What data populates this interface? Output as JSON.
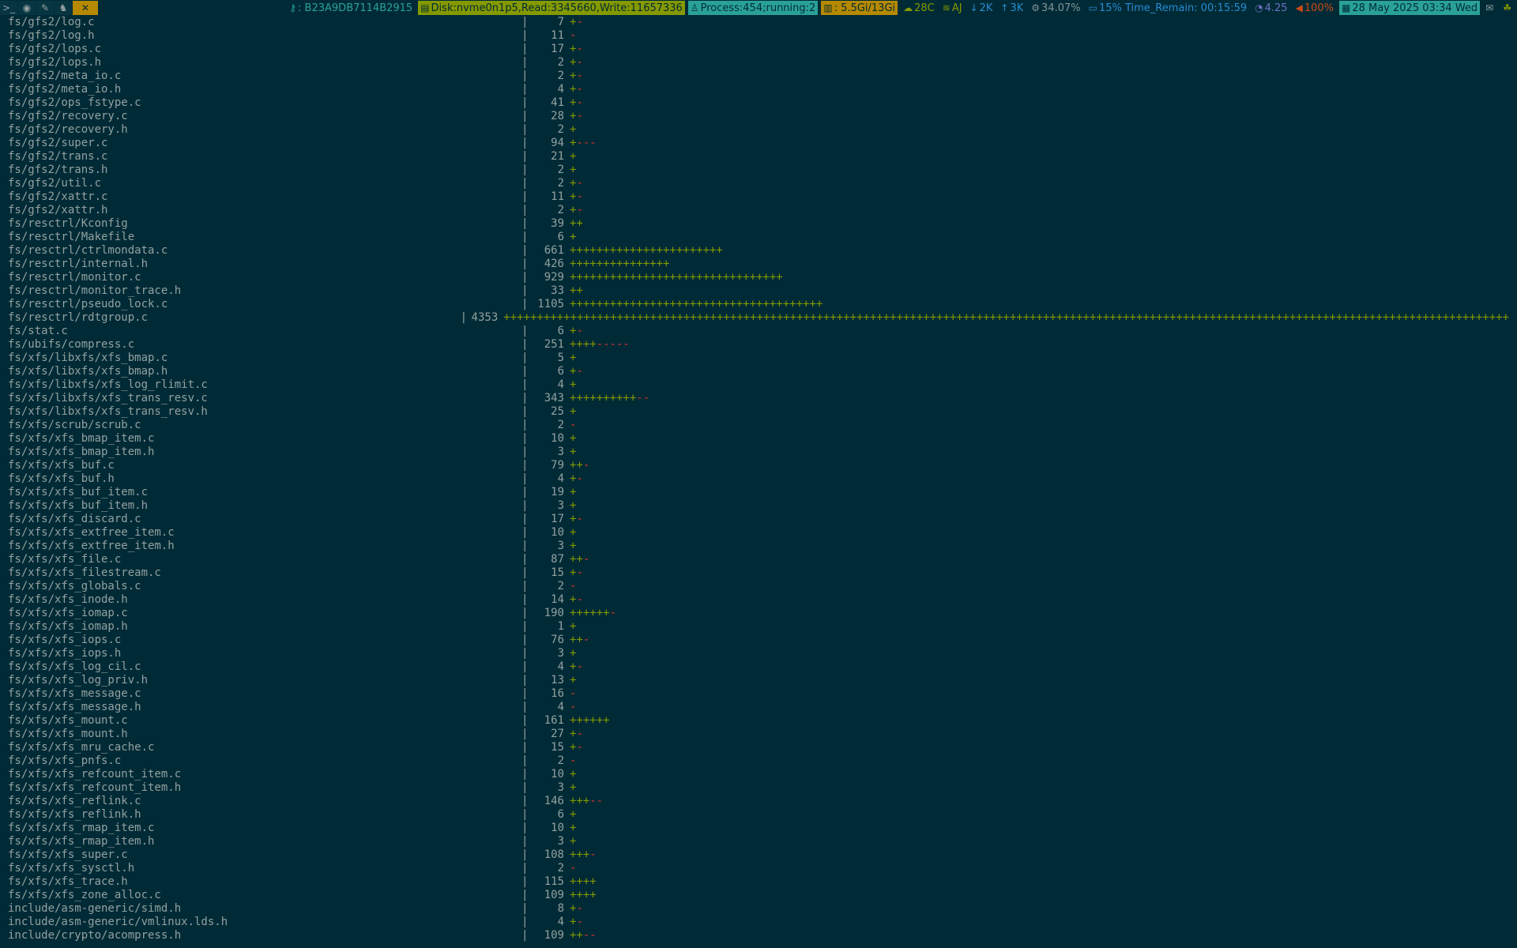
{
  "statusbar": {
    "workspaces": [
      {
        "icon": "terminal-icon",
        "glyph": ">_",
        "active": false
      },
      {
        "icon": "browser-icon",
        "glyph": "◉",
        "active": false
      },
      {
        "icon": "edit-icon",
        "glyph": "✎",
        "active": false
      },
      {
        "icon": "linux-icon",
        "glyph": "♞",
        "active": false
      },
      {
        "icon": "tools-icon",
        "glyph": "✕",
        "active": true
      }
    ],
    "blocks": [
      {
        "name": "key-status",
        "icon": "key-icon",
        "glyph": "⚷",
        "text": ": B23A9DB7114B2915",
        "fg": "#2aa198",
        "bg": "transparent"
      },
      {
        "name": "disk-status",
        "icon": "disk-icon",
        "glyph": "▤",
        "text": "Disk:nvme0n1p5,Read:3345660,Write:11657336",
        "fg": "#002b36",
        "bg": "#859900"
      },
      {
        "name": "process-status",
        "icon": "process-icon",
        "glyph": "♙",
        "text": "Process:454;running:2",
        "fg": "#002b36",
        "bg": "#2aa198"
      },
      {
        "name": "memory-status",
        "icon": "chart-icon",
        "glyph": "▥",
        "text": ": 5.5Gi/13Gi",
        "fg": "#002b36",
        "bg": "#b58900"
      },
      {
        "name": "temperature-status",
        "icon": "cloud-icon",
        "glyph": "☁",
        "text": "28C",
        "fg": "#859900",
        "bg": "transparent"
      },
      {
        "name": "wifi-status",
        "icon": "wifi-icon",
        "glyph": "≋",
        "text": "AJ",
        "fg": "#859900",
        "bg": "transparent"
      },
      {
        "name": "download-status",
        "icon": "download-icon",
        "glyph": "↓",
        "text": "2K",
        "fg": "#268bd2",
        "bg": "transparent"
      },
      {
        "name": "upload-status",
        "icon": "upload-icon",
        "glyph": "↑",
        "text": "3K",
        "fg": "#268bd2",
        "bg": "transparent"
      },
      {
        "name": "cpu-status",
        "icon": "gear-icon",
        "glyph": "⚙",
        "text": "34.07%",
        "fg": "#839496",
        "bg": "transparent"
      },
      {
        "name": "battery-status",
        "icon": "battery-icon",
        "glyph": "▭",
        "text": "15% Time_Remain: 00:15:59",
        "fg": "#268bd2",
        "bg": "transparent"
      },
      {
        "name": "load-status",
        "icon": "gauge-icon",
        "glyph": "◔",
        "text": "4.25",
        "fg": "#6c71c4",
        "bg": "transparent"
      },
      {
        "name": "volume-status",
        "icon": "volume-icon",
        "glyph": "◀",
        "text": "100%",
        "fg": "#cb4b16",
        "bg": "transparent"
      },
      {
        "name": "date-status",
        "icon": "calendar-icon",
        "glyph": "▦",
        "text": "28 May 2025 03:34 Wed",
        "fg": "#002b36",
        "bg": "#2aa198"
      },
      {
        "name": "mail-tray",
        "icon": "mail-icon",
        "glyph": "✉",
        "text": "",
        "fg": "#93a1a1",
        "bg": "transparent"
      },
      {
        "name": "network-tray",
        "icon": "network-icon",
        "glyph": "☘",
        "text": "",
        "fg": "#859900",
        "bg": "transparent"
      }
    ]
  },
  "terminal": {
    "separator": "|",
    "rows": [
      {
        "file": "fs/gfs2/log.c",
        "count": "7",
        "plus": "+",
        "minus": "-"
      },
      {
        "file": "fs/gfs2/log.h",
        "count": "11",
        "plus": "",
        "minus": "-"
      },
      {
        "file": "fs/gfs2/lops.c",
        "count": "17",
        "plus": "+",
        "minus": "-"
      },
      {
        "file": "fs/gfs2/lops.h",
        "count": "2",
        "plus": "+",
        "minus": "-"
      },
      {
        "file": "fs/gfs2/meta_io.c",
        "count": "2",
        "plus": "+",
        "minus": "-"
      },
      {
        "file": "fs/gfs2/meta_io.h",
        "count": "4",
        "plus": "+",
        "minus": "-"
      },
      {
        "file": "fs/gfs2/ops_fstype.c",
        "count": "41",
        "plus": "+",
        "minus": "-"
      },
      {
        "file": "fs/gfs2/recovery.c",
        "count": "28",
        "plus": "+",
        "minus": "-"
      },
      {
        "file": "fs/gfs2/recovery.h",
        "count": "2",
        "plus": "+",
        "minus": ""
      },
      {
        "file": "fs/gfs2/super.c",
        "count": "94",
        "plus": "+",
        "minus": "---"
      },
      {
        "file": "fs/gfs2/trans.c",
        "count": "21",
        "plus": "+",
        "minus": ""
      },
      {
        "file": "fs/gfs2/trans.h",
        "count": "2",
        "plus": "+",
        "minus": ""
      },
      {
        "file": "fs/gfs2/util.c",
        "count": "2",
        "plus": "+",
        "minus": "-"
      },
      {
        "file": "fs/gfs2/xattr.c",
        "count": "11",
        "plus": "+",
        "minus": "-"
      },
      {
        "file": "fs/gfs2/xattr.h",
        "count": "2",
        "plus": "+",
        "minus": "-"
      },
      {
        "file": "fs/resctrl/Kconfig",
        "count": "39",
        "plus": "++",
        "minus": ""
      },
      {
        "file": "fs/resctrl/Makefile",
        "count": "6",
        "plus": "+",
        "minus": ""
      },
      {
        "file": "fs/resctrl/ctrlmondata.c",
        "count": "661",
        "plus": "+++++++++++++++++++++++",
        "minus": ""
      },
      {
        "file": "fs/resctrl/internal.h",
        "count": "426",
        "plus": "+++++++++++++++",
        "minus": ""
      },
      {
        "file": "fs/resctrl/monitor.c",
        "count": "929",
        "plus": "++++++++++++++++++++++++++++++++",
        "minus": ""
      },
      {
        "file": "fs/resctrl/monitor_trace.h",
        "count": "33",
        "plus": "++",
        "minus": ""
      },
      {
        "file": "fs/resctrl/pseudo_lock.c",
        "count": "1105",
        "plus": "++++++++++++++++++++++++++++++++++++++",
        "minus": ""
      },
      {
        "file": "fs/resctrl/rdtgroup.c",
        "count": "4353",
        "plus": "+++++++++++++++++++++++++++++++++++++++++++++++++++++++++++++++++++++++++++++++++++++++++++++++++++++++++++++++++++++++++++++++++++++++++++++++++++++++",
        "minus": ""
      },
      {
        "file": "fs/stat.c",
        "count": "6",
        "plus": "+",
        "minus": "-"
      },
      {
        "file": "fs/ubifs/compress.c",
        "count": "251",
        "plus": "++++",
        "minus": "-----"
      },
      {
        "file": "fs/xfs/libxfs/xfs_bmap.c",
        "count": "5",
        "plus": "+",
        "minus": ""
      },
      {
        "file": "fs/xfs/libxfs/xfs_bmap.h",
        "count": "6",
        "plus": "+",
        "minus": "-"
      },
      {
        "file": "fs/xfs/libxfs/xfs_log_rlimit.c",
        "count": "4",
        "plus": "+",
        "minus": ""
      },
      {
        "file": "fs/xfs/libxfs/xfs_trans_resv.c",
        "count": "343",
        "plus": "++++++++++",
        "minus": "--"
      },
      {
        "file": "fs/xfs/libxfs/xfs_trans_resv.h",
        "count": "25",
        "plus": "+",
        "minus": ""
      },
      {
        "file": "fs/xfs/scrub/scrub.c",
        "count": "2",
        "plus": "",
        "minus": "-"
      },
      {
        "file": "fs/xfs/xfs_bmap_item.c",
        "count": "10",
        "plus": "+",
        "minus": ""
      },
      {
        "file": "fs/xfs/xfs_bmap_item.h",
        "count": "3",
        "plus": "+",
        "minus": ""
      },
      {
        "file": "fs/xfs/xfs_buf.c",
        "count": "79",
        "plus": "++",
        "minus": "-"
      },
      {
        "file": "fs/xfs/xfs_buf.h",
        "count": "4",
        "plus": "+",
        "minus": "-"
      },
      {
        "file": "fs/xfs/xfs_buf_item.c",
        "count": "19",
        "plus": "+",
        "minus": ""
      },
      {
        "file": "fs/xfs/xfs_buf_item.h",
        "count": "3",
        "plus": "+",
        "minus": ""
      },
      {
        "file": "fs/xfs/xfs_discard.c",
        "count": "17",
        "plus": "+",
        "minus": "-"
      },
      {
        "file": "fs/xfs/xfs_extfree_item.c",
        "count": "10",
        "plus": "+",
        "minus": ""
      },
      {
        "file": "fs/xfs/xfs_extfree_item.h",
        "count": "3",
        "plus": "+",
        "minus": ""
      },
      {
        "file": "fs/xfs/xfs_file.c",
        "count": "87",
        "plus": "++",
        "minus": "-"
      },
      {
        "file": "fs/xfs/xfs_filestream.c",
        "count": "15",
        "plus": "+",
        "minus": "-"
      },
      {
        "file": "fs/xfs/xfs_globals.c",
        "count": "2",
        "plus": "",
        "minus": "-"
      },
      {
        "file": "fs/xfs/xfs_inode.h",
        "count": "14",
        "plus": "+",
        "minus": "-"
      },
      {
        "file": "fs/xfs/xfs_iomap.c",
        "count": "190",
        "plus": "++++++",
        "minus": "-"
      },
      {
        "file": "fs/xfs/xfs_iomap.h",
        "count": "1",
        "plus": "+",
        "minus": ""
      },
      {
        "file": "fs/xfs/xfs_iops.c",
        "count": "76",
        "plus": "++",
        "minus": "-"
      },
      {
        "file": "fs/xfs/xfs_iops.h",
        "count": "3",
        "plus": "+",
        "minus": ""
      },
      {
        "file": "fs/xfs/xfs_log_cil.c",
        "count": "4",
        "plus": "+",
        "minus": "-"
      },
      {
        "file": "fs/xfs/xfs_log_priv.h",
        "count": "13",
        "plus": "+",
        "minus": ""
      },
      {
        "file": "fs/xfs/xfs_message.c",
        "count": "16",
        "plus": "",
        "minus": "-"
      },
      {
        "file": "fs/xfs/xfs_message.h",
        "count": "4",
        "plus": "",
        "minus": "-"
      },
      {
        "file": "fs/xfs/xfs_mount.c",
        "count": "161",
        "plus": "++++++",
        "minus": ""
      },
      {
        "file": "fs/xfs/xfs_mount.h",
        "count": "27",
        "plus": "+",
        "minus": "-"
      },
      {
        "file": "fs/xfs/xfs_mru_cache.c",
        "count": "15",
        "plus": "+",
        "minus": "-"
      },
      {
        "file": "fs/xfs/xfs_pnfs.c",
        "count": "2",
        "plus": "",
        "minus": "-"
      },
      {
        "file": "fs/xfs/xfs_refcount_item.c",
        "count": "10",
        "plus": "+",
        "minus": ""
      },
      {
        "file": "fs/xfs/xfs_refcount_item.h",
        "count": "3",
        "plus": "+",
        "minus": ""
      },
      {
        "file": "fs/xfs/xfs_reflink.c",
        "count": "146",
        "plus": "+++",
        "minus": "--"
      },
      {
        "file": "fs/xfs/xfs_reflink.h",
        "count": "6",
        "plus": "+",
        "minus": ""
      },
      {
        "file": "fs/xfs/xfs_rmap_item.c",
        "count": "10",
        "plus": "+",
        "minus": ""
      },
      {
        "file": "fs/xfs/xfs_rmap_item.h",
        "count": "3",
        "plus": "+",
        "minus": ""
      },
      {
        "file": "fs/xfs/xfs_super.c",
        "count": "108",
        "plus": "+++",
        "minus": "-"
      },
      {
        "file": "fs/xfs/xfs_sysctl.h",
        "count": "2",
        "plus": "",
        "minus": "-"
      },
      {
        "file": "fs/xfs/xfs_trace.h",
        "count": "115",
        "plus": "++++",
        "minus": ""
      },
      {
        "file": "fs/xfs/xfs_zone_alloc.c",
        "count": "109",
        "plus": "++++",
        "minus": ""
      },
      {
        "file": "include/asm-generic/simd.h",
        "count": "8",
        "plus": "+",
        "minus": "-"
      },
      {
        "file": "include/asm-generic/vmlinux.lds.h",
        "count": "4",
        "plus": "+",
        "minus": "-"
      },
      {
        "file": "include/crypto/acompress.h",
        "count": "109",
        "plus": "++",
        "minus": "--"
      }
    ]
  }
}
